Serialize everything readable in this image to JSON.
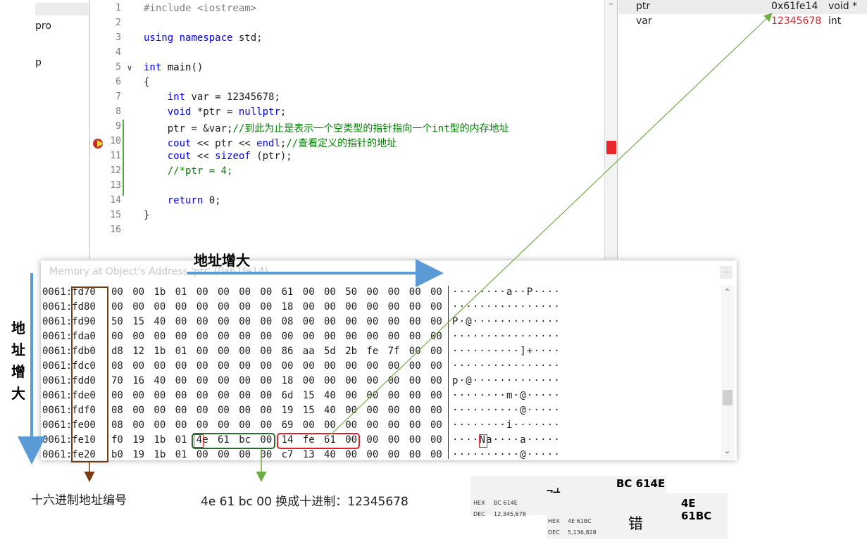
{
  "explorer": {
    "items": [
      "pro",
      "p"
    ]
  },
  "editor": {
    "line_numbers": [
      "1",
      "2",
      "3",
      "4",
      "5",
      "6",
      "7",
      "8",
      "9",
      "10",
      "11",
      "12",
      "13",
      "14",
      "15",
      "16"
    ],
    "lines": [
      [
        {
          "t": "#include <iostream>",
          "c": "pp"
        }
      ],
      [],
      [
        {
          "t": "using",
          "c": "kw"
        },
        {
          "t": " ",
          "c": ""
        },
        {
          "t": "namespace",
          "c": "kw"
        },
        {
          "t": " std;",
          "c": ""
        }
      ],
      [],
      [
        {
          "t": "int",
          "c": "kw"
        },
        {
          "t": " ",
          "c": ""
        },
        {
          "t": "main",
          "c": "fn"
        },
        {
          "t": "()",
          "c": ""
        }
      ],
      [
        {
          "t": "{",
          "c": ""
        }
      ],
      [
        {
          "t": "    ",
          "c": ""
        },
        {
          "t": "int",
          "c": "kw"
        },
        {
          "t": " var = 12345678;",
          "c": ""
        }
      ],
      [
        {
          "t": "    ",
          "c": ""
        },
        {
          "t": "void",
          "c": "kw"
        },
        {
          "t": " *ptr = ",
          "c": ""
        },
        {
          "t": "nullptr",
          "c": "kw"
        },
        {
          "t": ";",
          "c": ""
        }
      ],
      [
        {
          "t": "    ptr = &var;",
          "c": ""
        },
        {
          "t": "//到此为止是表示一个空类型的指针指向一个int型的内存地址",
          "c": "cm"
        }
      ],
      [
        {
          "t": "    ",
          "c": ""
        },
        {
          "t": "cout",
          "c": "kw"
        },
        {
          "t": " << ptr << ",
          "c": ""
        },
        {
          "t": "endl",
          "c": "kw"
        },
        {
          "t": ";",
          "c": ""
        },
        {
          "t": "//查看定义的指针的地址",
          "c": "cm"
        }
      ],
      [
        {
          "t": "    ",
          "c": ""
        },
        {
          "t": "cout",
          "c": "kw"
        },
        {
          "t": " << ",
          "c": ""
        },
        {
          "t": "sizeof",
          "c": "kw"
        },
        {
          "t": " (ptr);",
          "c": ""
        }
      ],
      [
        {
          "t": "    ",
          "c": ""
        },
        {
          "t": "//*ptr = 4;",
          "c": "cm"
        }
      ],
      [],
      [
        {
          "t": "    ",
          "c": ""
        },
        {
          "t": "return",
          "c": "kw"
        },
        {
          "t": " 0;",
          "c": ""
        }
      ],
      [
        {
          "t": "}",
          "c": ""
        }
      ],
      []
    ]
  },
  "watch": {
    "rows": [
      {
        "name": "ptr",
        "value": "0x61fe14",
        "type": "void *"
      },
      {
        "name": "var",
        "value": "12345678",
        "type": "int"
      }
    ]
  },
  "memory": {
    "title": "Memory at Object's Address 'ptr' (0x61fe14)",
    "rows": [
      {
        "addr": "0061:fd70",
        "bytes": [
          "00",
          "00",
          "1b",
          "01",
          "00",
          "00",
          "00",
          "00",
          "61",
          "00",
          "00",
          "50",
          "00",
          "00",
          "00",
          "00"
        ],
        "ascii": "········a··P····"
      },
      {
        "addr": "0061:fd80",
        "bytes": [
          "00",
          "00",
          "00",
          "00",
          "00",
          "00",
          "00",
          "00",
          "18",
          "00",
          "00",
          "00",
          "00",
          "00",
          "00",
          "00"
        ],
        "ascii": "················"
      },
      {
        "addr": "0061:fd90",
        "bytes": [
          "50",
          "15",
          "40",
          "00",
          "00",
          "00",
          "00",
          "00",
          "08",
          "00",
          "00",
          "00",
          "00",
          "00",
          "00",
          "00"
        ],
        "ascii": "P·@·············"
      },
      {
        "addr": "0061:fda0",
        "bytes": [
          "00",
          "00",
          "00",
          "00",
          "00",
          "00",
          "00",
          "00",
          "00",
          "00",
          "00",
          "00",
          "00",
          "00",
          "00",
          "00"
        ],
        "ascii": "················"
      },
      {
        "addr": "0061:fdb0",
        "bytes": [
          "d8",
          "12",
          "1b",
          "01",
          "00",
          "00",
          "00",
          "00",
          "86",
          "aa",
          "5d",
          "2b",
          "fe",
          "7f",
          "00",
          "00"
        ],
        "ascii": "··········]+····"
      },
      {
        "addr": "0061:fdc0",
        "bytes": [
          "08",
          "00",
          "00",
          "00",
          "00",
          "00",
          "00",
          "00",
          "00",
          "00",
          "00",
          "00",
          "00",
          "00",
          "00",
          "00"
        ],
        "ascii": "················"
      },
      {
        "addr": "0061:fdd0",
        "bytes": [
          "70",
          "16",
          "40",
          "00",
          "00",
          "00",
          "00",
          "00",
          "18",
          "00",
          "00",
          "00",
          "00",
          "00",
          "00",
          "00"
        ],
        "ascii": "p·@·············"
      },
      {
        "addr": "0061:fde0",
        "bytes": [
          "00",
          "00",
          "00",
          "00",
          "00",
          "00",
          "00",
          "00",
          "6d",
          "15",
          "40",
          "00",
          "00",
          "00",
          "00",
          "00"
        ],
        "ascii": "········m·@·····"
      },
      {
        "addr": "0061:fdf0",
        "bytes": [
          "08",
          "00",
          "00",
          "00",
          "00",
          "00",
          "00",
          "00",
          "19",
          "15",
          "40",
          "00",
          "00",
          "00",
          "00",
          "00"
        ],
        "ascii": "··········@·····"
      },
      {
        "addr": "0061:fe00",
        "bytes": [
          "08",
          "00",
          "00",
          "00",
          "00",
          "00",
          "00",
          "00",
          "69",
          "00",
          "00",
          "00",
          "00",
          "00",
          "00",
          "00"
        ],
        "ascii": "········i·······"
      },
      {
        "addr": "0061:fe10",
        "bytes": [
          "f0",
          "19",
          "1b",
          "01",
          "4e",
          "61",
          "bc",
          "00",
          "14",
          "fe",
          "61",
          "00",
          "00",
          "00",
          "00",
          "00"
        ],
        "ascii": "····Na····a·····"
      },
      {
        "addr": "0061:fe20",
        "bytes": [
          "b0",
          "19",
          "1b",
          "01",
          "00",
          "00",
          "00",
          "00",
          "c7",
          "13",
          "40",
          "00",
          "00",
          "00",
          "00",
          "00"
        ],
        "ascii": "··········@·····"
      }
    ]
  },
  "annotations": {
    "addr_increase": "地址增大",
    "addr_increase_v": [
      "地",
      "址",
      "增",
      "大"
    ],
    "hex_label": "十六进制地址编号",
    "convert_label": "4e 61 bc 00 换成十进制：12345678"
  },
  "calc": {
    "right_label": "对",
    "right_big": "BC 614E",
    "right_hex_key": "HEX",
    "right_hex_val": "BC 614E",
    "right_dec_key": "DEC",
    "right_dec_val": "12,345,678",
    "wrong_label": "错",
    "wrong_big": "4E 61BC",
    "wrong_hex_key": "HEX",
    "wrong_hex_val": "4E 61BC",
    "wrong_dec_key": "DEC",
    "wrong_dec_val": "5,136,828"
  },
  "colors": {
    "comment": "#008000",
    "keyword": "#0000ff",
    "changed_value": "#e3262b",
    "arrow_blue": "#5b9bd5",
    "arrow_green": "#70ad47",
    "box_brown": "#7a3b12",
    "box_green": "#2e6b2e",
    "box_red": "#d6262b"
  }
}
